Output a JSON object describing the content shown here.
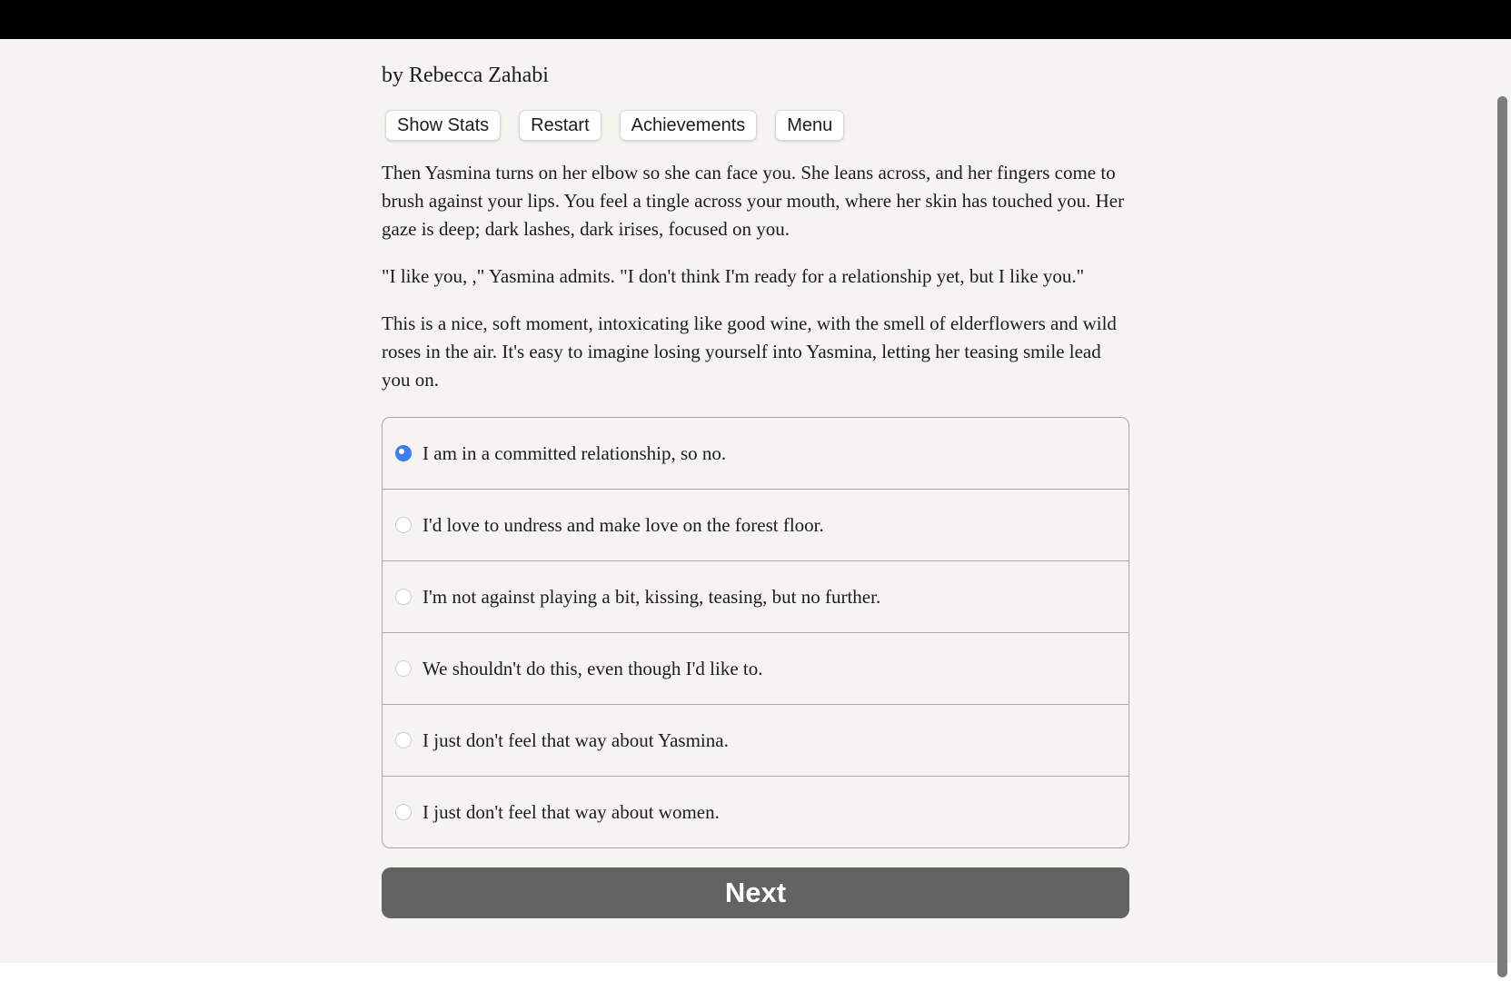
{
  "author_line": "by Rebecca Zahabi",
  "toolbar": {
    "buttons": [
      {
        "label": "Show Stats"
      },
      {
        "label": "Restart"
      },
      {
        "label": "Achievements"
      },
      {
        "label": "Menu"
      }
    ]
  },
  "passage": [
    "Then Yasmina turns on her elbow so she can face you. She leans across, and her fingers come to brush against your lips. You feel a tingle across your mouth, where her skin has touched you. Her gaze is deep; dark lashes, dark irises, focused on you.",
    "\"I like you, ,\" Yasmina admits. \"I don't think I'm ready for a relationship yet, but I like you.\"",
    "This is a nice, soft moment, intoxicating like good wine, with the smell of elderflowers and wild roses in the air. It's easy to imagine losing yourself into Yasmina, letting her teasing smile lead you on."
  ],
  "choices": [
    {
      "label": "I am in a committed relationship, so no.",
      "selected": true
    },
    {
      "label": "I'd love to undress and make love on the forest floor.",
      "selected": false
    },
    {
      "label": "I'm not against playing a bit, kissing, teasing, but no further.",
      "selected": false
    },
    {
      "label": "We shouldn't do this, even though I'd like to.",
      "selected": false
    },
    {
      "label": "I just don't feel that way about Yasmina.",
      "selected": false
    },
    {
      "label": "I just don't feel that way about women.",
      "selected": false
    }
  ],
  "next_label": "Next",
  "colors": {
    "background": "#f5f4f0",
    "radio_selected": "#3b7ff0",
    "next_button": "#636363"
  }
}
